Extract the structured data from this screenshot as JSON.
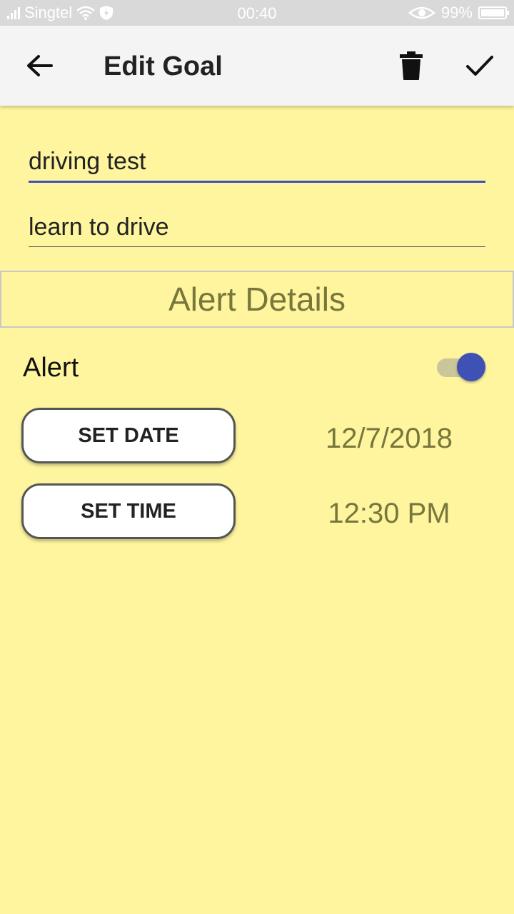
{
  "status_bar": {
    "carrier": "Singtel",
    "time": "00:40",
    "battery": "99%"
  },
  "app_bar": {
    "title": "Edit Goal"
  },
  "form": {
    "title_value": "driving test",
    "description_value": "learn to drive"
  },
  "alert_section": {
    "header": "Alert Details",
    "alert_label": "Alert",
    "alert_enabled": true,
    "set_date_label": "SET DATE",
    "date_value": "12/7/2018",
    "set_time_label": "SET TIME",
    "time_value": "12:30 PM"
  },
  "colors": {
    "background": "#fef59e",
    "accent": "#3f51b5",
    "secondary_text": "#77763c"
  },
  "icons": [
    "signal-icon",
    "wifi-icon",
    "shield-icon",
    "eye-icon",
    "battery-icon",
    "back-arrow-icon",
    "trash-icon",
    "check-icon"
  ]
}
